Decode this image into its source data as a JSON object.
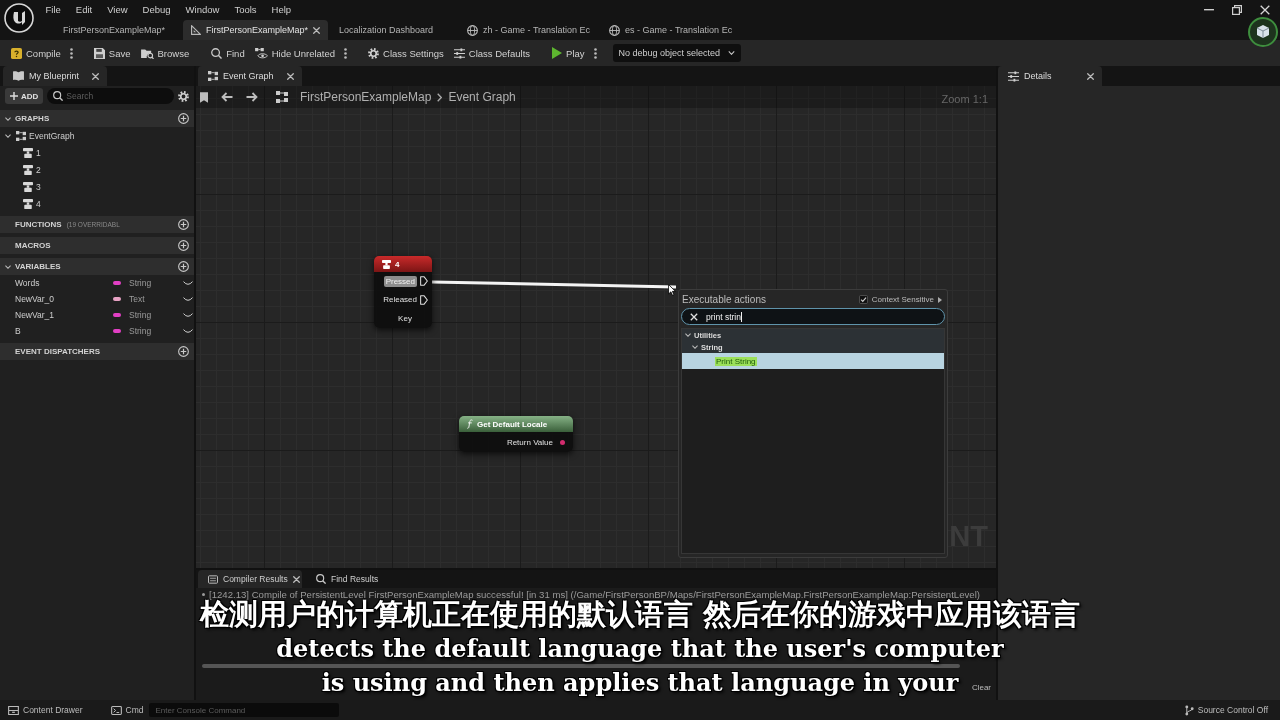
{
  "title_bar": {
    "menu": [
      "File",
      "Edit",
      "View",
      "Debug",
      "Window",
      "Tools",
      "Help"
    ],
    "tabs": [
      {
        "label": "FirstPersonExampleMap*",
        "kind": "plain",
        "selected": false
      },
      {
        "label": "FirstPersonExampleMap*",
        "kind": "blueprint",
        "selected": true
      },
      {
        "label": "Localization Dashboard",
        "kind": "plain",
        "selected": false
      },
      {
        "label": "zh - Game - Translation Ec",
        "kind": "translation",
        "selected": false
      },
      {
        "label": "es - Game - Translation Ec",
        "kind": "translation",
        "selected": false
      }
    ]
  },
  "toolbar": {
    "groups": [
      [
        {
          "label": "Compile",
          "kind": "compile",
          "options": true
        }
      ],
      [
        {
          "label": "Save",
          "kind": "save",
          "options": false
        },
        {
          "label": "Browse",
          "kind": "browse",
          "options": false
        }
      ],
      [
        {
          "label": "Find",
          "kind": "find",
          "options": false
        },
        {
          "label": "Hide Unrelated",
          "kind": "hide_unrelated",
          "options": true
        }
      ],
      [
        {
          "label": "Class Settings",
          "kind": "class_settings",
          "options": false
        },
        {
          "label": "Class Defaults",
          "kind": "class_defaults",
          "options": false
        }
      ],
      [
        {
          "label": "Play",
          "kind": "play",
          "options": true
        }
      ]
    ],
    "debug_object": "No debug object selected"
  },
  "my_blueprint": {
    "tab": "My Blueprint",
    "add_button": "ADD",
    "search": {
      "placeholder": "Search"
    },
    "sections": [
      {
        "title": "GRAPHS",
        "expanded": true,
        "tree": [
          {
            "label": "EventGraph",
            "kind": "graph",
            "expanded": true,
            "children": [
              {
                "label": "1",
                "kind": "key_event"
              },
              {
                "label": "2",
                "kind": "key_event"
              },
              {
                "label": "3",
                "kind": "key_event"
              },
              {
                "label": "4",
                "kind": "key_event"
              }
            ]
          }
        ]
      },
      {
        "title": "FUNCTIONS",
        "note": "(19 OVERRIDABL",
        "expanded": false
      },
      {
        "title": "MACROS",
        "expanded": false
      },
      {
        "title": "VARIABLES",
        "expanded": true,
        "variables": [
          {
            "name": "Words",
            "type": "String",
            "color": "#e23fc4"
          },
          {
            "name": "NewVar_0",
            "type": "Text",
            "color": "#e8a2c4"
          },
          {
            "name": "NewVar_1",
            "type": "String",
            "color": "#e23fc4"
          },
          {
            "name": "B",
            "type": "String",
            "color": "#e23fc4"
          }
        ]
      },
      {
        "title": "EVENT DISPATCHERS",
        "expanded": false
      }
    ]
  },
  "event_graph": {
    "tab": "Event Graph",
    "breadcrumb": [
      "FirstPersonExampleMap",
      "Event Graph"
    ],
    "zoom": "Zoom 1:1",
    "corner_label": "NT",
    "nodes": [
      {
        "kind": "input_key",
        "title": "4",
        "pins": [
          {
            "label": "Pressed",
            "kind": "exec",
            "hovered": true
          },
          {
            "label": "Released",
            "kind": "exec",
            "hovered": false
          },
          {
            "label": "Key",
            "kind": "struct",
            "hovered": false
          }
        ]
      },
      {
        "kind": "function",
        "title": "Get Default Locale",
        "pins": [
          {
            "label": "Return Value",
            "kind": "string",
            "hovered": false
          }
        ]
      }
    ],
    "action_menu": {
      "title": "Executable actions",
      "context_sensitive": {
        "label": "Context Sensitive",
        "checked": true
      },
      "search": {
        "value": "print strin"
      },
      "tree": [
        {
          "label": "Utilities",
          "expanded": true,
          "selected": false,
          "children": [
            {
              "label": "String",
              "expanded": true,
              "selected": false,
              "children": [
                {
                  "label": "Print String",
                  "selected": true
                }
              ]
            }
          ]
        }
      ]
    }
  },
  "compiler_results": {
    "tabs": [
      {
        "label": "Compiler Results",
        "kind": "compiler",
        "selected": true
      },
      {
        "label": "Find Results",
        "kind": "find",
        "selected": false
      }
    ],
    "log": [
      "[1242.13] Compile of PersistentLevel FirstPersonExampleMap successful! [in 31 ms] (/Game/FirstPersonBP/Maps/FirstPersonExampleMap.FirstPersonExampleMap:PersistentLevel)"
    ],
    "clear_button": "Clear"
  },
  "details": {
    "tab": "Details"
  },
  "status_bar": {
    "content_drawer": "Content Drawer",
    "cmd": "Cmd",
    "console": {
      "placeholder": "Enter Console Command"
    },
    "source_control": "Source Control Off"
  },
  "subtitles": {
    "zh": "检测用户的计算机正在使用的默认语言 然后在你的游戏中应用该语言",
    "en": [
      "detects the default language that the user's computer",
      "is using and then applies that language in your"
    ]
  }
}
